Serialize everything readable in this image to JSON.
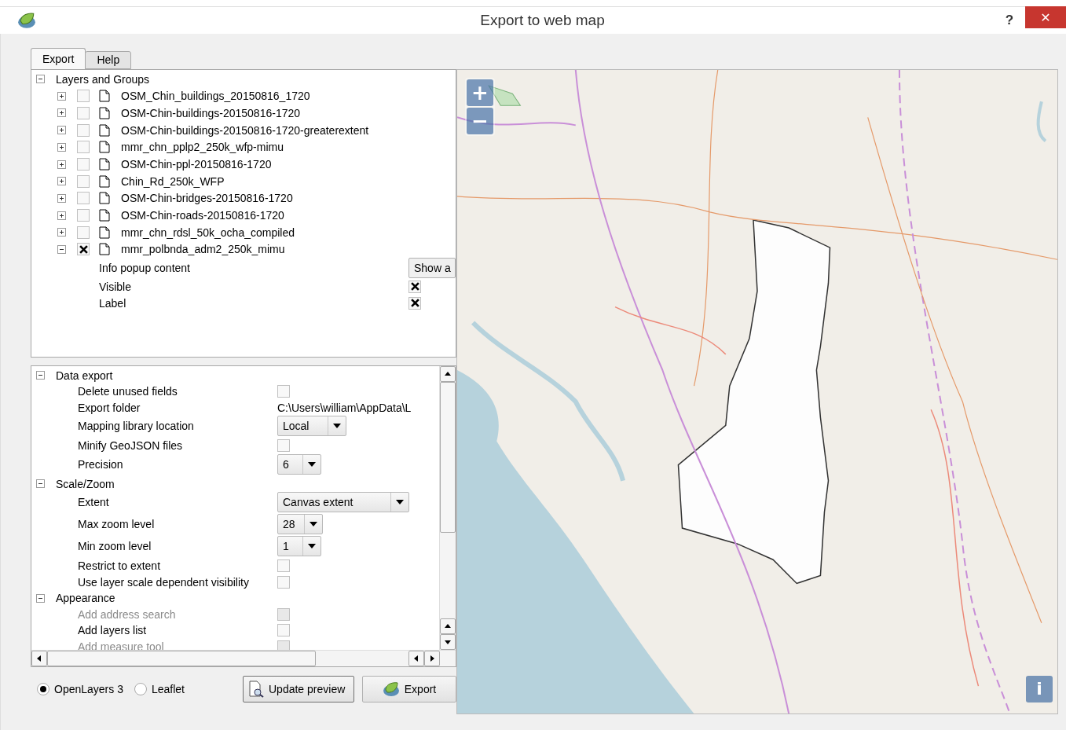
{
  "window": {
    "title": "Export to web map",
    "help": "?",
    "close": "✕"
  },
  "tabs": [
    {
      "label": "Export",
      "selected": true
    },
    {
      "label": "Help",
      "selected": false
    }
  ],
  "layers": {
    "title": "Layers and Groups",
    "expanded": true,
    "items": [
      {
        "name": "OSM_Chin_buildings_20150816_1720",
        "checked": false,
        "expanded": false
      },
      {
        "name": "OSM-Chin-buildings-20150816-1720",
        "checked": false,
        "expanded": false
      },
      {
        "name": "OSM-Chin-buildings-20150816-1720-greaterextent",
        "checked": false,
        "expanded": false
      },
      {
        "name": "mmr_chn_pplp2_250k_wfp-mimu",
        "checked": false,
        "expanded": false
      },
      {
        "name": "OSM-Chin-ppl-20150816-1720",
        "checked": false,
        "expanded": false
      },
      {
        "name": "Chin_Rd_250k_WFP",
        "checked": false,
        "expanded": false
      },
      {
        "name": "OSM-Chin-bridges-20150816-1720",
        "checked": false,
        "expanded": false
      },
      {
        "name": "OSM-Chin-roads-20150816-1720",
        "checked": false,
        "expanded": false
      },
      {
        "name": "mmr_chn_rdsl_50k_ocha_compiled",
        "checked": false,
        "expanded": false
      },
      {
        "name": "mmr_polbnda_adm2_250k_mimu",
        "checked": true,
        "expanded": true,
        "children": [
          {
            "kind": "button",
            "label": "Info popup content",
            "value": "Show a"
          },
          {
            "kind": "checkbox",
            "label": "Visible",
            "checked": true
          },
          {
            "kind": "checkbox",
            "label": "Label",
            "checked": true
          }
        ]
      }
    ]
  },
  "settings": [
    {
      "title": "Data export",
      "expanded": true,
      "children": [
        {
          "kind": "checkbox",
          "label": "Delete unused fields",
          "checked": false,
          "disabled": false
        },
        {
          "kind": "text",
          "label": "Export folder",
          "value": "C:\\Users\\william\\AppData\\L"
        },
        {
          "kind": "select",
          "label": "Mapping library location",
          "value": "Local"
        },
        {
          "kind": "checkbox",
          "label": "Minify GeoJSON files",
          "checked": false,
          "disabled": false
        },
        {
          "kind": "select",
          "label": "Precision",
          "value": "6"
        }
      ]
    },
    {
      "title": "Scale/Zoom",
      "expanded": true,
      "children": [
        {
          "kind": "select",
          "label": "Extent",
          "value": "Canvas extent"
        },
        {
          "kind": "select",
          "label": "Max zoom level",
          "value": "28"
        },
        {
          "kind": "select",
          "label": "Min zoom level",
          "value": "1"
        },
        {
          "kind": "checkbox",
          "label": "Restrict to extent",
          "checked": false,
          "disabled": false
        },
        {
          "kind": "checkbox",
          "label": "Use layer scale dependent visibility",
          "checked": false,
          "disabled": false
        }
      ]
    },
    {
      "title": "Appearance",
      "expanded": true,
      "children": [
        {
          "kind": "checkbox",
          "label": "Add address search",
          "checked": false,
          "disabled": true
        },
        {
          "kind": "checkbox",
          "label": "Add layers list",
          "checked": false,
          "disabled": false
        },
        {
          "kind": "checkbox",
          "label": "Add measure tool",
          "checked": false,
          "disabled": true
        }
      ]
    }
  ],
  "libraries": [
    {
      "label": "OpenLayers 3",
      "selected": true
    },
    {
      "label": "Leaflet",
      "selected": false
    }
  ],
  "actions": [
    {
      "kind": "preview",
      "label": "Update preview"
    },
    {
      "kind": "export",
      "label": "Export"
    }
  ],
  "map": {
    "kind": "picture",
    "zoom_in": "+",
    "zoom_out": "−",
    "info": "i"
  }
}
